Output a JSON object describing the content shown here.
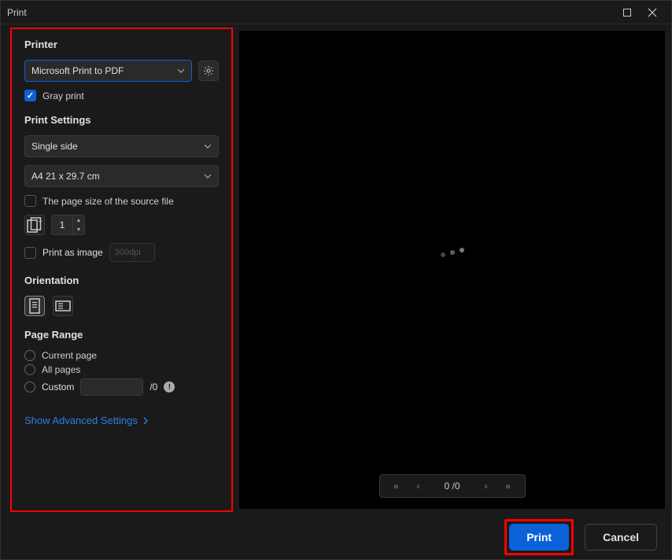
{
  "window": {
    "title": "Print"
  },
  "printer": {
    "header": "Printer",
    "selected": "Microsoft Print to PDF",
    "gray_print_label": "Gray print",
    "gray_print_checked": true
  },
  "print_settings": {
    "header": "Print Settings",
    "duplex": "Single side",
    "paper": "A4 21 x 29.7 cm",
    "use_source_size_label": "The page size of the source file",
    "use_source_size_checked": false,
    "copies": "1",
    "print_as_image_label": "Print as image",
    "print_as_image_checked": false,
    "dpi_placeholder": "300dpi"
  },
  "orientation": {
    "header": "Orientation",
    "selected": "portrait"
  },
  "page_range": {
    "header": "Page Range",
    "current_label": "Current page",
    "all_label": "All pages",
    "custom_label": "Custom",
    "custom_value": "",
    "total_suffix": "/0",
    "selected": "none"
  },
  "advanced": {
    "label": "Show Advanced Settings"
  },
  "pager": {
    "text": "0 /0"
  },
  "footer": {
    "print": "Print",
    "cancel": "Cancel"
  }
}
